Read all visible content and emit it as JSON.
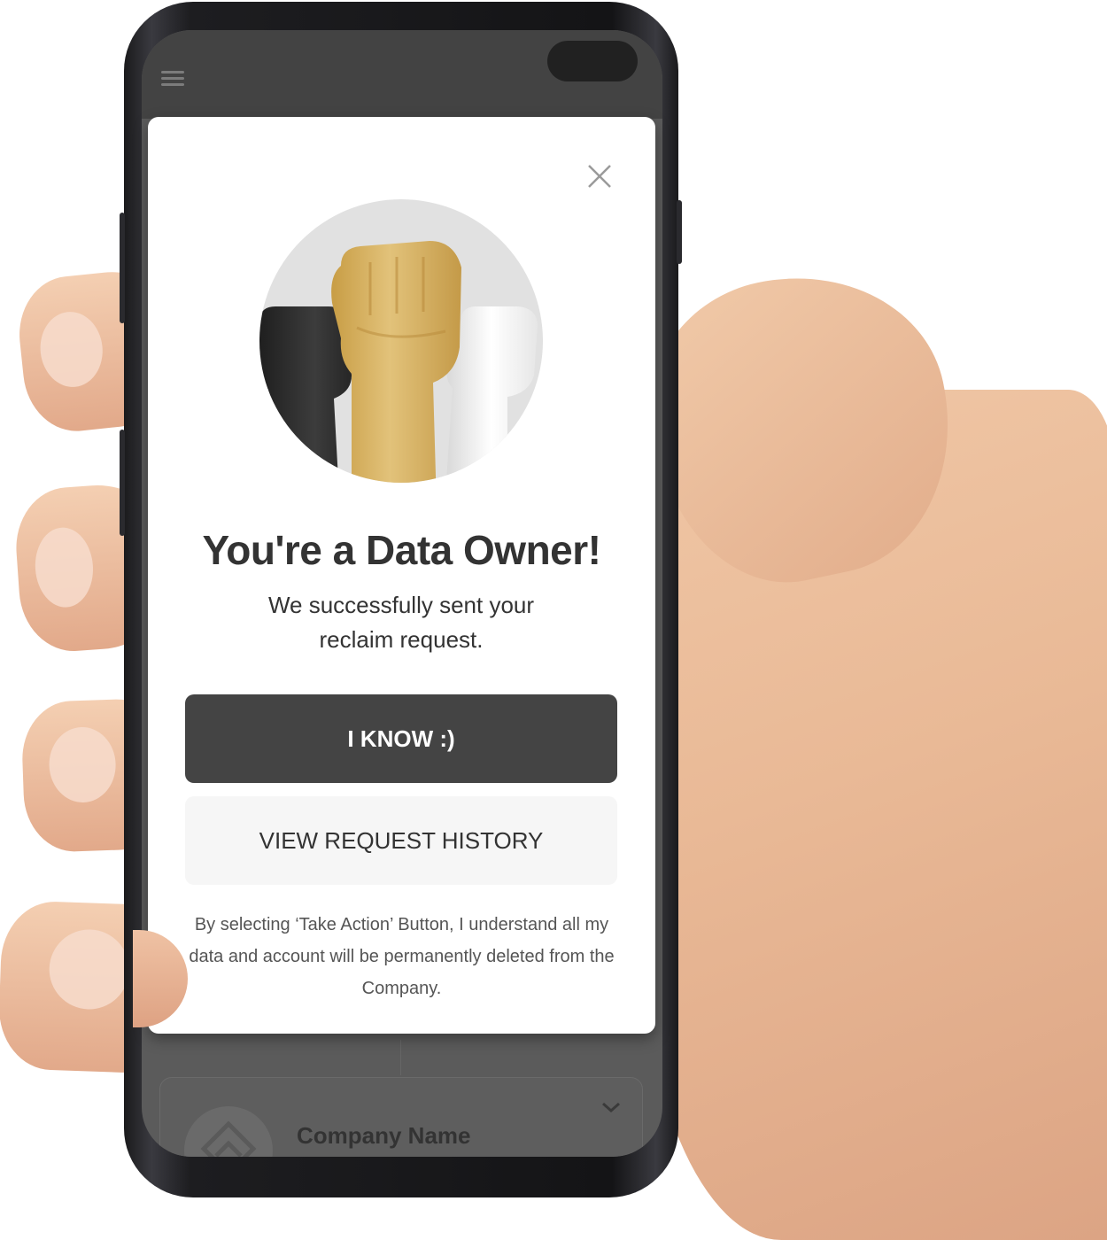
{
  "modal": {
    "title": "You're a Data Owner!",
    "message": "We successfully sent your reclaim request.",
    "primary_button": "I KNOW :)",
    "secondary_button": "VIEW REQUEST HISTORY",
    "disclaimer": "By selecting ‘Take Action’ Button, I understand all my data and account will be permanently deleted from the Company.",
    "close_icon": "close-icon",
    "hero_icon": "raised-fists-illustration"
  },
  "background_list": {
    "company_name": "Company Name",
    "expand_icon": "chevron-down-icon",
    "avatar_icon": "company-logo-icon"
  },
  "app_bar": {
    "menu_icon": "hamburger-menu-icon"
  },
  "colors": {
    "primary_button": "#444444",
    "secondary_button": "#f6f6f6",
    "text": "#333333",
    "overlay": "#5b5b5b",
    "fist_gold": "#d8b45f"
  }
}
